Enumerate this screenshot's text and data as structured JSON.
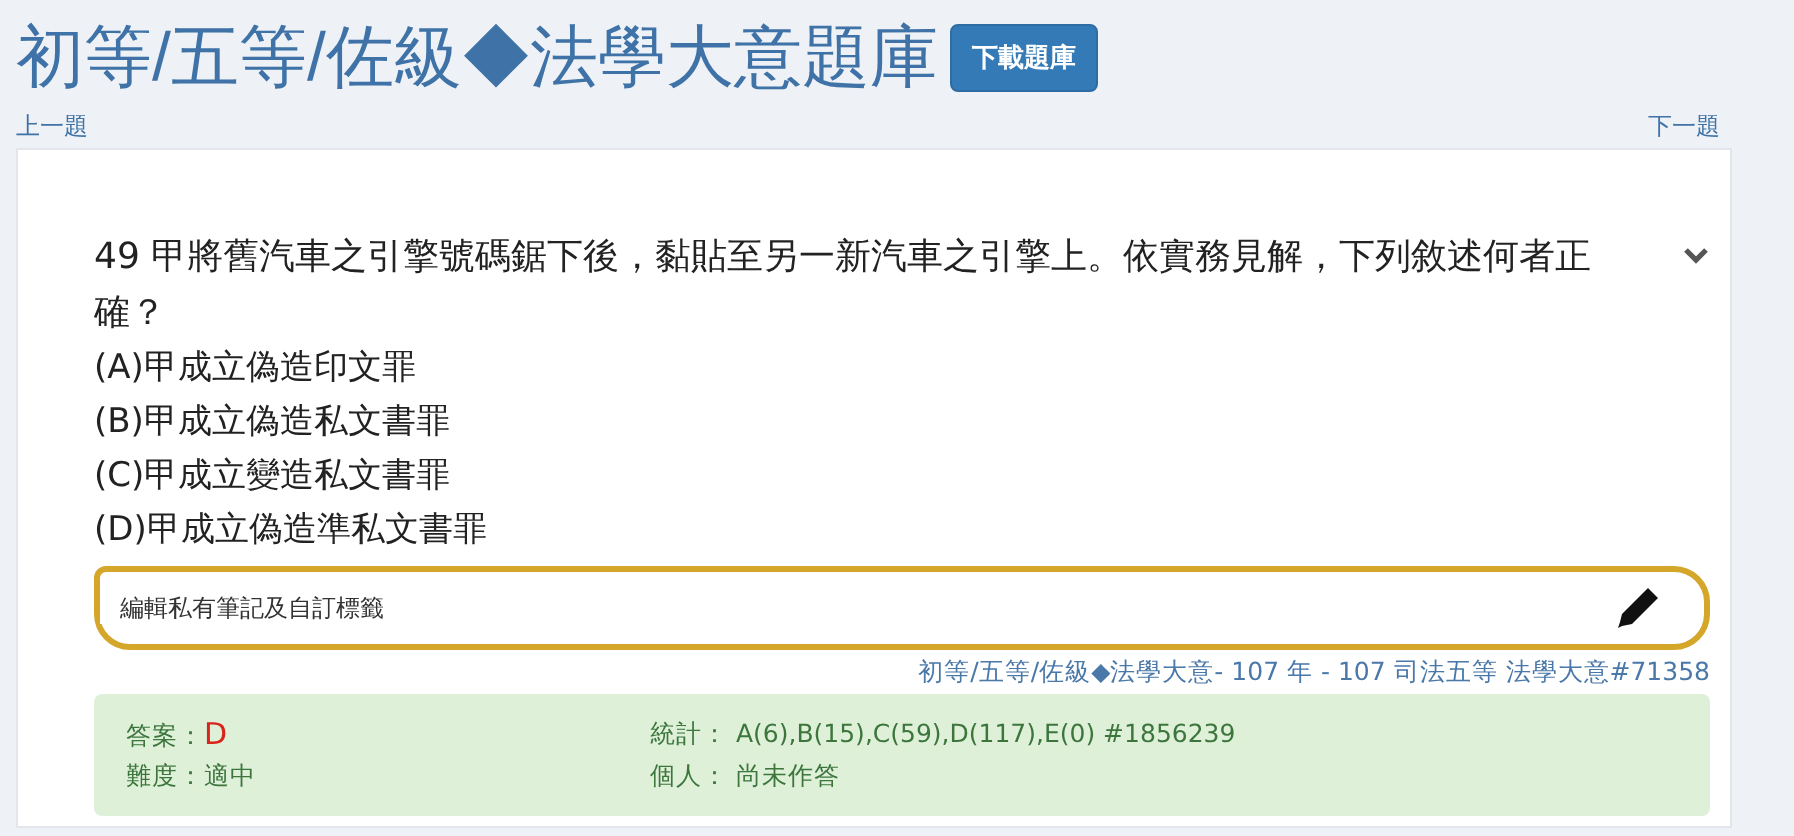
{
  "title": "初等/五等/佐級◆法學大意題庫",
  "download_button": "下載題庫",
  "nav": {
    "prev": "上一題",
    "next": "下一題"
  },
  "question": {
    "number": "49",
    "text": "甲將舊汽車之引擎號碼鋸下後，黏貼至另一新汽車之引擎上。依實務見解，下列敘述何者正確？",
    "expanded": false,
    "options": [
      "(A)甲成立偽造印文罪",
      "(B)甲成立偽造私文書罪",
      "(C)甲成立變造私文書罪",
      "(D)甲成立偽造準私文書罪"
    ]
  },
  "note": {
    "placeholder": "編輯私有筆記及自訂標籤"
  },
  "source": "初等/五等/佐級◆法學大意- 107 年 - 107 司法五等 法學大意#71358",
  "info": {
    "answer_label": "答案：",
    "answer": "D",
    "difficulty": "難度：適中",
    "stats": "統計： A(6),B(15),C(59),D(117),E(0) #1856239",
    "personal": "個人： 尚未作答"
  }
}
